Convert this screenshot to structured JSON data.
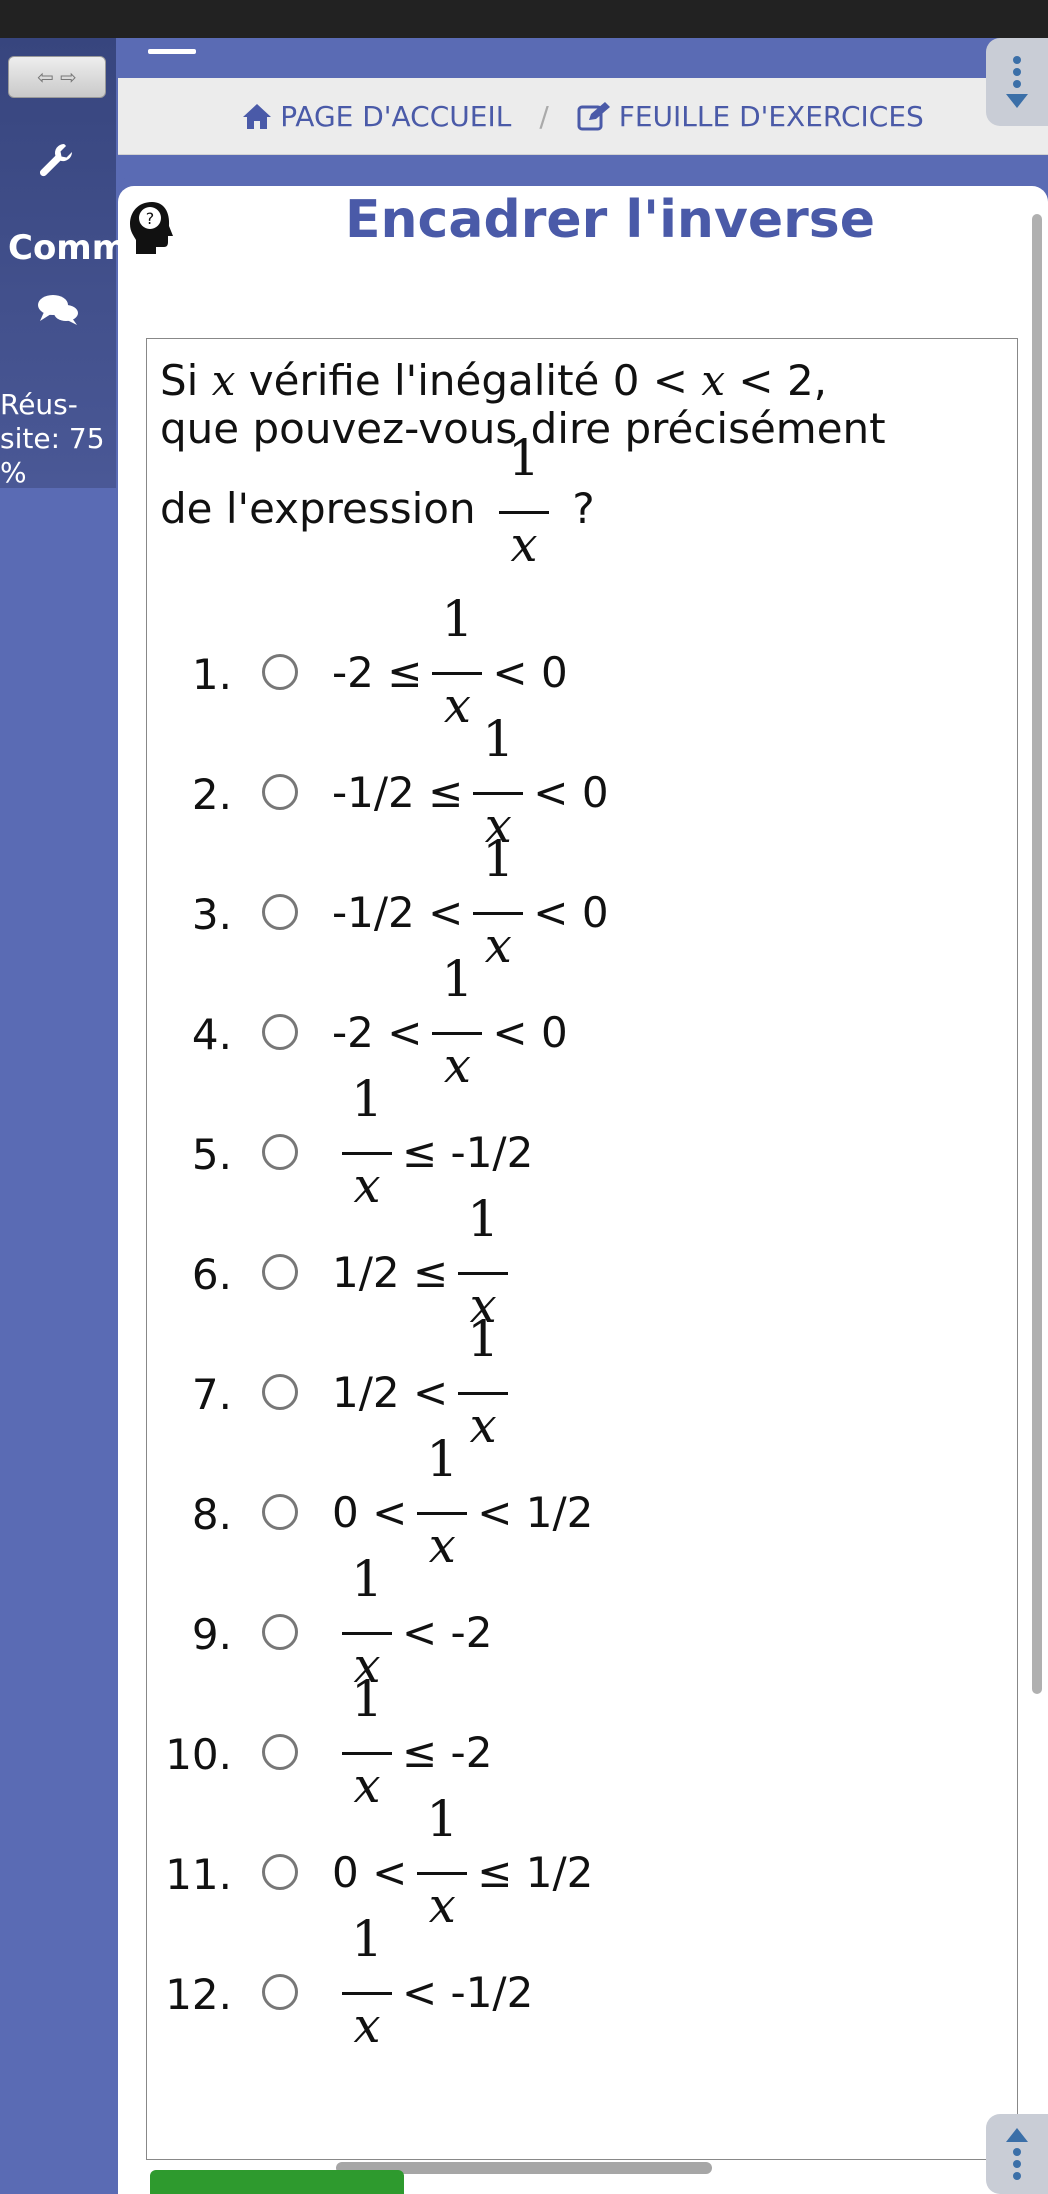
{
  "nav": {
    "breadcrumbs": [
      {
        "label": "PAGE D'ACCUEIL"
      },
      {
        "label": "FEUILLE D'EXERCICES"
      }
    ],
    "arrows_label": "⇦ ⇨"
  },
  "sidebar": {
    "comm_label": "Comm",
    "reussite_label": "Réus-\nsite: 75\n%"
  },
  "exercise": {
    "title": "Encadrer l'inverse",
    "question_line1_pre": "Si ",
    "question_var": "x",
    "question_line1_post": " vérifie l'inégalité 0 < ",
    "question_line1_end": " < 2,",
    "question_line2": "que pouvez-vous dire précisément",
    "question_line3": "de l'expression",
    "question_mark": "?",
    "fraction_num": "1",
    "fraction_den": "x"
  },
  "options": [
    {
      "num": "1.",
      "pre": "-2 ≤",
      "post": "< 0"
    },
    {
      "num": "2.",
      "pre": "-1/2 ≤",
      "post": "< 0"
    },
    {
      "num": "3.",
      "pre": "-1/2 <",
      "post": "< 0"
    },
    {
      "num": "4.",
      "pre": "-2 <",
      "post": "< 0"
    },
    {
      "num": "5.",
      "pre": "",
      "post": "≤ -1/2"
    },
    {
      "num": "6.",
      "pre": "1/2 ≤",
      "post": ""
    },
    {
      "num": "7.",
      "pre": "1/2 <",
      "post": ""
    },
    {
      "num": "8.",
      "pre": "0 <",
      "post": "< 1/2"
    },
    {
      "num": "9.",
      "pre": "",
      "post": "< -2"
    },
    {
      "num": "10.",
      "pre": "",
      "post": "≤ -2"
    },
    {
      "num": "11.",
      "pre": "0 <",
      "post": "≤ 1/2"
    },
    {
      "num": "12.",
      "pre": "",
      "post": "< -1/2"
    }
  ],
  "colors": {
    "brand": "#5a6bb4",
    "title": "#4a5aa8",
    "button": "#2e9a2e"
  }
}
